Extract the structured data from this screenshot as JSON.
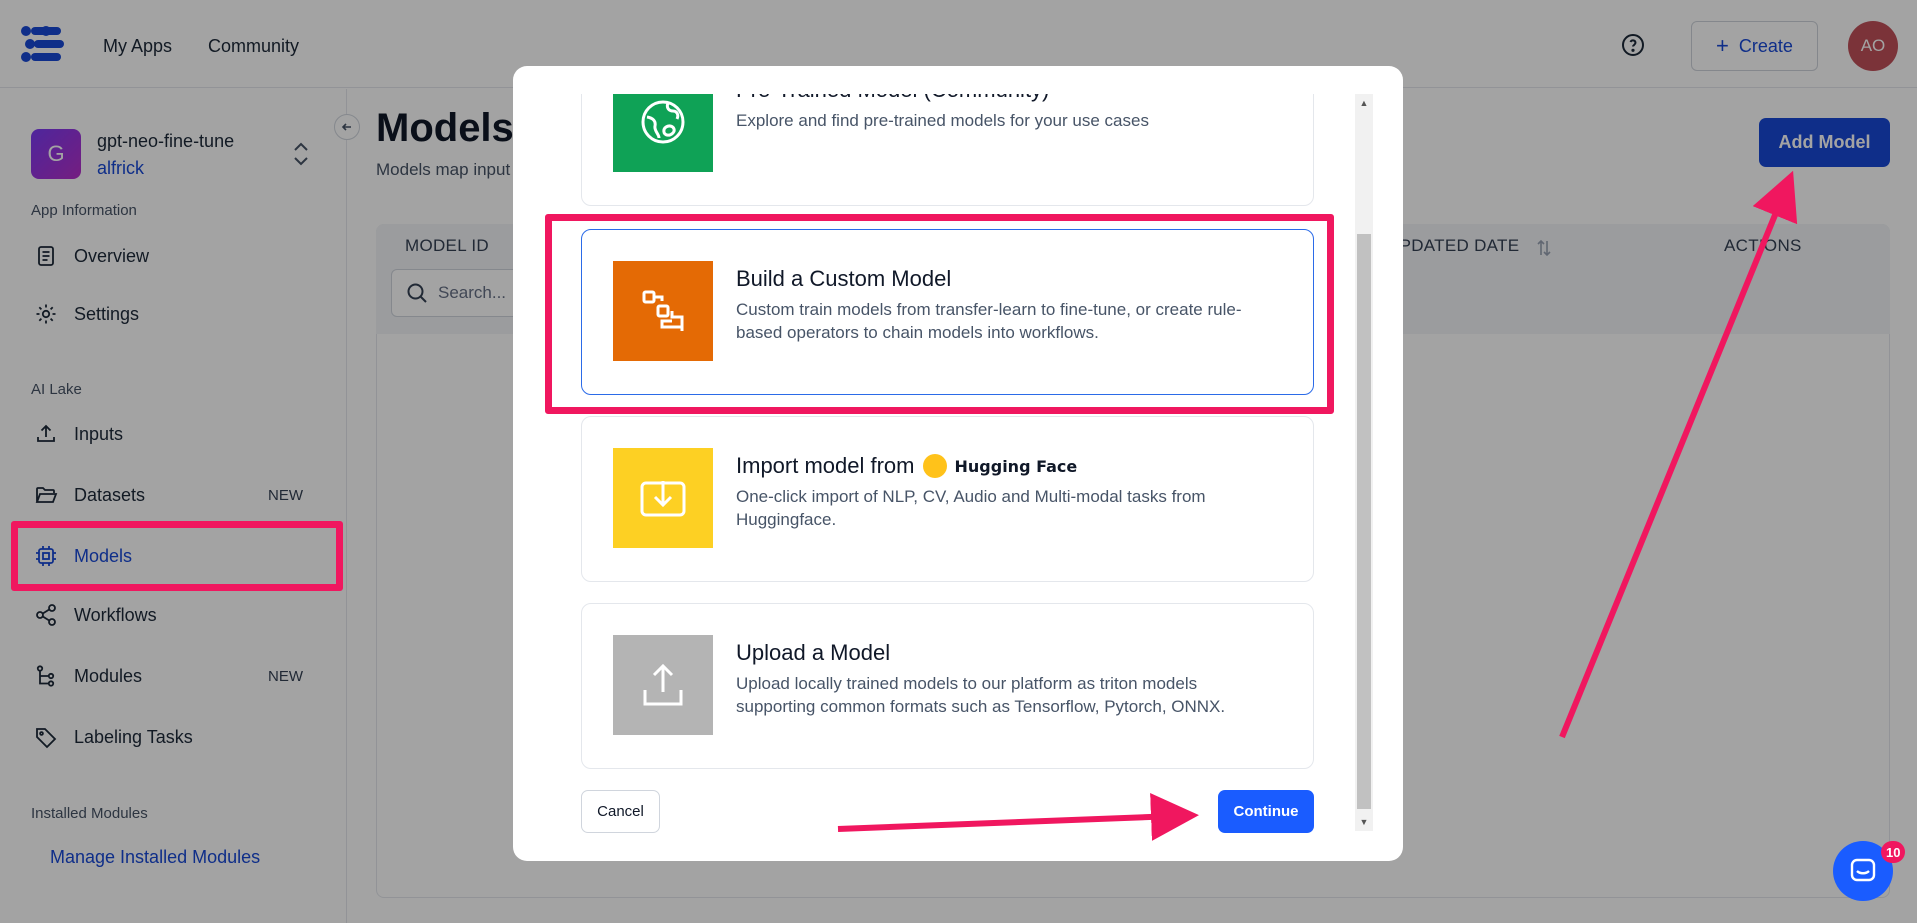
{
  "topnav": {
    "my_apps": "My Apps",
    "community": "Community",
    "create_label": "Create",
    "avatar_initials": "AO"
  },
  "sidebar": {
    "app_initial": "G",
    "app_name": "gpt-neo-fine-tune",
    "app_owner": "alfrick",
    "section_app_info": "App Information",
    "overview": "Overview",
    "settings": "Settings",
    "section_ai_lake": "AI Lake",
    "inputs": "Inputs",
    "datasets": "Datasets",
    "datasets_badge": "NEW",
    "models": "Models",
    "workflows": "Workflows",
    "modules": "Modules",
    "modules_badge": "NEW",
    "labeling_tasks": "Labeling Tasks",
    "section_installed": "Installed Modules",
    "manage_installed": "Manage Installed Modules"
  },
  "main": {
    "title": "Models",
    "subtitle": "Models map input",
    "add_model": "Add Model",
    "columns": {
      "model_id": "MODEL ID",
      "updated_date": "UPDATED DATE",
      "actions": "ACTIONS"
    },
    "search_placeholder": "Search..."
  },
  "modal": {
    "options": [
      {
        "title": "Pre-Trained Model (Community)",
        "desc": "Explore and find pre-trained models for your use cases",
        "color": "#0fa256",
        "icon": "globe-icon"
      },
      {
        "title": "Build a Custom Model",
        "desc": "Custom train models from transfer-learn to fine-tune, or create rule-based operators to chain models into workflows.",
        "color": "#e46a05",
        "icon": "blocks-icon"
      },
      {
        "title": "Import model from",
        "brand": "Hugging Face",
        "desc": "One-click import of NLP, CV, Audio and Multi-modal tasks from Huggingface.",
        "color": "#fdd023",
        "icon": "download-icon"
      },
      {
        "title": "Upload a Model",
        "desc": "Upload locally trained models to our platform as triton models supporting common formats such as Tensorflow, Pytorch, ONNX.",
        "color": "#b4b4b4",
        "icon": "upload-icon"
      }
    ],
    "cancel": "Cancel",
    "continue": "Continue"
  },
  "chat": {
    "unread_count": "10"
  },
  "colors": {
    "accent": "#1849d6",
    "primary_button": "#1a5cff",
    "annotation": "#f0175f"
  }
}
